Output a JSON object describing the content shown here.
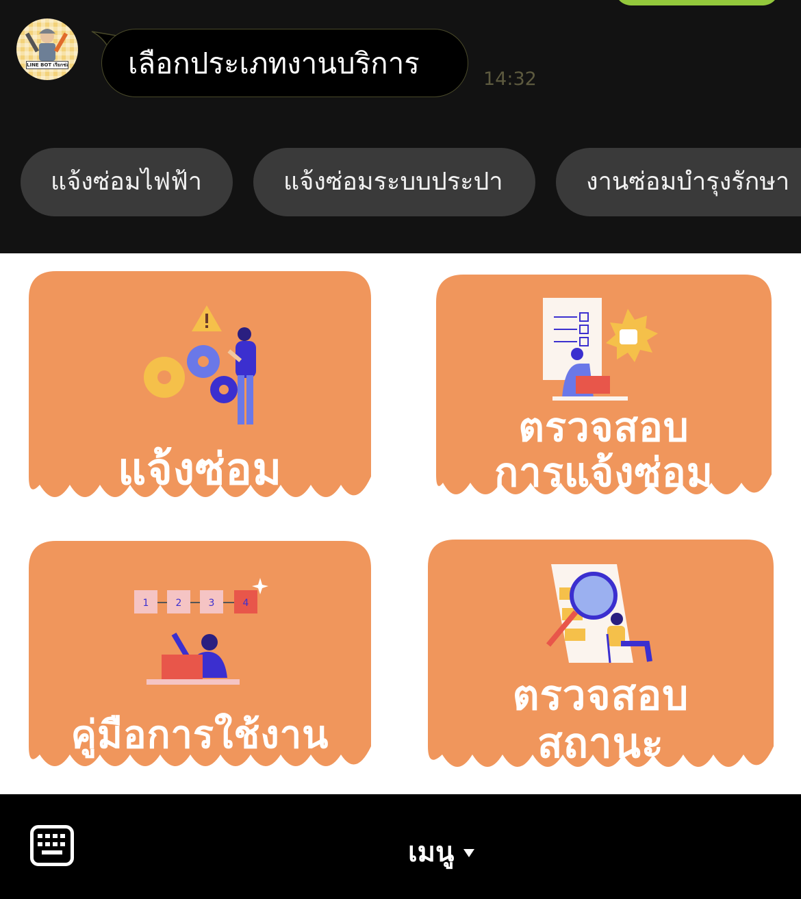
{
  "chat": {
    "message": "เลือกประเภทงานบริการ",
    "time": "14:32",
    "avatar_label": "LINE BOT เรียกช่อม",
    "quick_replies": [
      "แจ้งซ่อมไฟฟ้า",
      "แจ้งซ่อมระบบประปา",
      "งานซ่อมบำรุงรักษา"
    ]
  },
  "rich_menu": {
    "cards": [
      {
        "line1": "แจ้งซ่อม",
        "line2": ""
      },
      {
        "line1": "ตรวจสอบ",
        "line2": "การแจ้งซ่อม"
      },
      {
        "line1": "คู่มือการใช้งาน",
        "line2": ""
      },
      {
        "line1": "ตรวจสอบ",
        "line2": "สถานะ"
      }
    ],
    "steps": [
      "1",
      "2",
      "3",
      "4"
    ],
    "card_color": "#f0965c"
  },
  "bottom_bar": {
    "menu_label": "เมนู",
    "keyboard_icon": "keyboard-icon",
    "caret_icon": "caret-down-icon"
  }
}
